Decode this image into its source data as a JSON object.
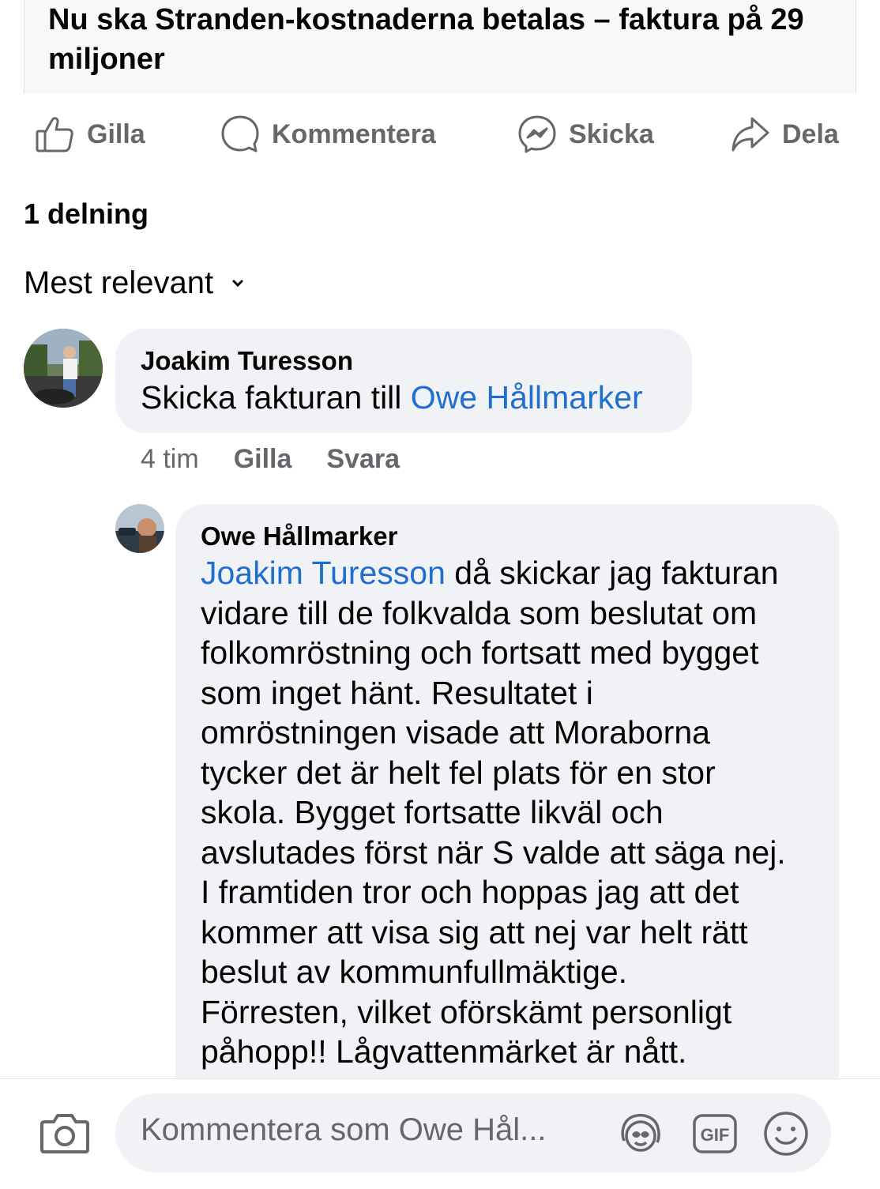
{
  "post": {
    "link_title": "Nu ska Stranden-kostnaderna betalas – faktura på 29 miljoner"
  },
  "actions": {
    "like": "Gilla",
    "comment": "Kommentera",
    "send": "Skicka",
    "share": "Dela"
  },
  "shares_count": "1 delning",
  "sort_label": "Mest relevant",
  "comments": [
    {
      "author": "Joakim Turesson",
      "text_before": "Skicka fakturan till ",
      "mention": "Owe Hållmarker",
      "time": "4 tim",
      "like": "Gilla",
      "reply": "Svara"
    },
    {
      "author": "Owe Hållmarker",
      "mention": "Joakim Turesson",
      "lines": [
        " då skickar jag fakturan",
        "vidare till de folkvalda som beslutat om",
        "folkomröstning och fortsatt med bygget",
        "som inget hänt. Resultatet i",
        "omröstningen visade att Moraborna",
        "tycker det är helt fel plats för en stor",
        "skola. Bygget  fortsatte likväl och",
        "avslutades först när S valde att säga nej.",
        "I framtiden tror och hoppas jag att det",
        "kommer att visa sig att nej var helt rätt",
        "beslut av kommunfullmäktige.",
        "Förresten, vilket oförskämt personligt",
        "påhopp!! Lågvattenmärket är nått."
      ]
    }
  ],
  "composer": {
    "placeholder": "Kommentera som Owe Hål..."
  },
  "colors": {
    "mention": "#1f6fd1",
    "bubble": "#f0f2f5",
    "secondary_text": "#65676b"
  }
}
